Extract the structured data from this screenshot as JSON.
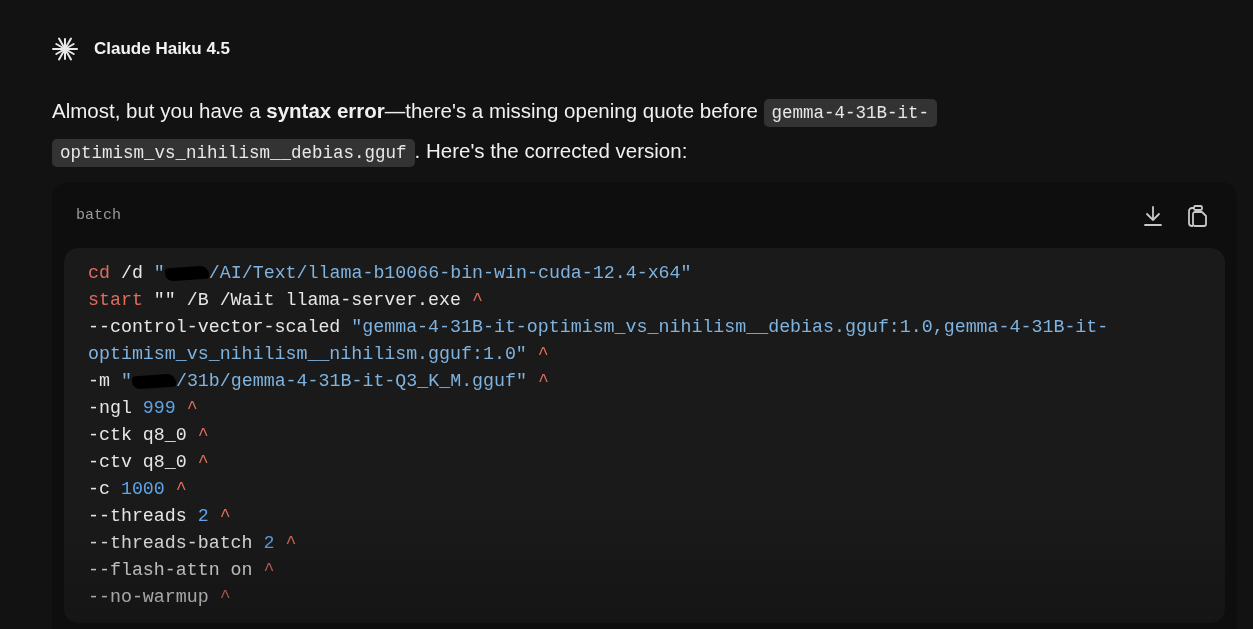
{
  "header": {
    "model_name": "Claude Haiku 4.5"
  },
  "message": {
    "text": "Almost, but you have a **syntax error**—there's a missing opening quote before ",
    "inline_code": "gemma-4-31B-it-optimism_vs_nihilism__debias.gguf",
    "text_after": ". Here's the corrected version:"
  },
  "code_block": {
    "language": "batch",
    "lines": [
      [
        {
          "kind": "keyword",
          "text": "cd"
        },
        {
          "kind": "plain",
          "text": " /d "
        },
        {
          "kind": "string",
          "text": "\""
        },
        {
          "kind": "redacted"
        },
        {
          "kind": "string",
          "text": "/AI/Text/llama-b10066-bin-win-cuda-12.4-x64\""
        }
      ],
      [
        {
          "kind": "keyword",
          "text": "start"
        },
        {
          "kind": "plain",
          "text": " \"\" /B /Wait llama-server.exe "
        },
        {
          "kind": "caret",
          "text": "^"
        }
      ],
      [
        {
          "kind": "plain",
          "text": "--control-vector-scaled "
        },
        {
          "kind": "string",
          "text": "\"gemma-4-31B-it-optimism_vs_nihilism__debias.gguf:1.0,gemma-4-31B-it-"
        }
      ],
      [
        {
          "kind": "string",
          "text": "optimism_vs_nihilism__nihilism.gguf:1.0\" "
        },
        {
          "kind": "caret",
          "text": "^"
        }
      ],
      [
        {
          "kind": "plain",
          "text": "-m "
        },
        {
          "kind": "string",
          "text": "\""
        },
        {
          "kind": "redacted"
        },
        {
          "kind": "string",
          "text": "/31b/gemma-4-31B-it-Q3_K_M.gguf\" "
        },
        {
          "kind": "caret",
          "text": "^"
        }
      ],
      [
        {
          "kind": "plain",
          "text": "-ngl "
        },
        {
          "kind": "number",
          "text": "999 "
        },
        {
          "kind": "caret",
          "text": "^"
        }
      ],
      [
        {
          "kind": "plain",
          "text": "-ctk q8_0 "
        },
        {
          "kind": "caret",
          "text": "^"
        }
      ],
      [
        {
          "kind": "plain",
          "text": "-ctv q8_0 "
        },
        {
          "kind": "caret",
          "text": "^"
        }
      ],
      [
        {
          "kind": "plain",
          "text": "-c "
        },
        {
          "kind": "number",
          "text": "1000 "
        },
        {
          "kind": "caret",
          "text": "^"
        }
      ],
      [
        {
          "kind": "plain",
          "text": "--threads "
        },
        {
          "kind": "number",
          "text": "2 "
        },
        {
          "kind": "caret",
          "text": "^"
        }
      ],
      [
        {
          "kind": "plain",
          "text": "--threads-batch "
        },
        {
          "kind": "number",
          "text": "2 "
        },
        {
          "kind": "caret",
          "text": "^"
        }
      ],
      [
        {
          "kind": "plain",
          "text": "--flash-attn on "
        },
        {
          "kind": "caret",
          "text": "^"
        }
      ],
      [
        {
          "kind": "plain",
          "text": "--no-warmup "
        },
        {
          "kind": "caret",
          "text": "^"
        }
      ]
    ]
  }
}
